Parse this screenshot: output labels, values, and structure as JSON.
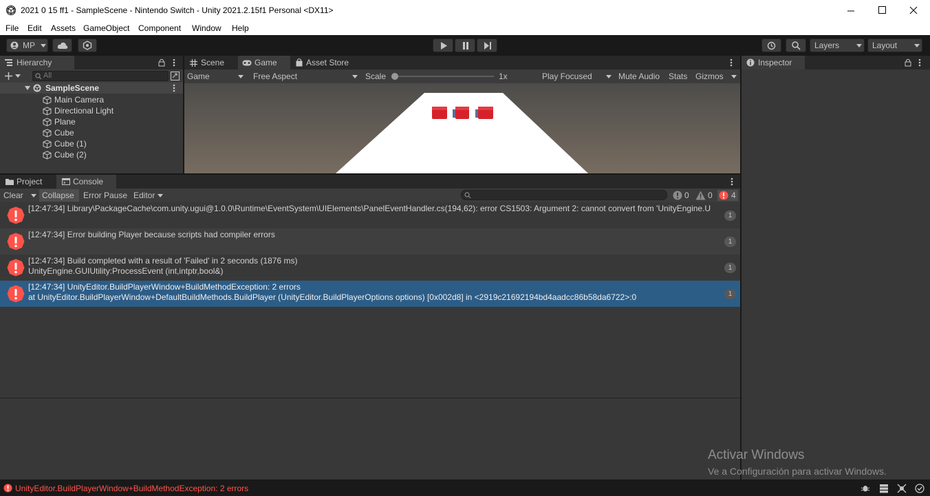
{
  "window": {
    "title": "2021 0 15 ff1 - SampleScene - Nintendo Switch - Unity 2021.2.15f1 Personal <DX11>"
  },
  "menu": [
    "File",
    "Edit",
    "Assets",
    "GameObject",
    "Component",
    "Window",
    "Help"
  ],
  "toolbar": {
    "account": "MP",
    "layers": "Layers",
    "layout": "Layout"
  },
  "hierarchy": {
    "tab": "Hierarchy",
    "search_placeholder": "All",
    "scene": "SampleScene",
    "items": [
      "Main Camera",
      "Directional Light",
      "Plane",
      "Cube",
      "Cube (1)",
      "Cube (2)"
    ]
  },
  "center_tabs": [
    "Scene",
    "Game",
    "Asset Store"
  ],
  "game_bar": {
    "display": "Game",
    "aspect": "Free Aspect",
    "scale_label": "Scale",
    "scale_value": "1x",
    "play_mode": "Play Focused",
    "mute": "Mute Audio",
    "stats": "Stats",
    "gizmos": "Gizmos"
  },
  "inspector": {
    "tab": "Inspector"
  },
  "bottom_tabs": [
    "Project",
    "Console"
  ],
  "console": {
    "clear": "Clear",
    "collapse": "Collapse",
    "error_pause": "Error Pause",
    "editor": "Editor",
    "info_count": "0",
    "warn_count": "0",
    "error_count": "4",
    "logs": [
      {
        "line1": "[12:47:34] Library\\PackageCache\\com.unity.ugui@1.0.0\\Runtime\\EventSystem\\UIElements\\PanelEventHandler.cs(194,62): error CS1503: Argument 2: cannot convert from 'UnityEngine.U",
        "line2": "",
        "count": "1",
        "selected": false
      },
      {
        "line1": "[12:47:34] Error building Player because scripts had compiler errors",
        "line2": "",
        "count": "1",
        "selected": false
      },
      {
        "line1": "[12:47:34] Build completed with a result of 'Failed' in 2 seconds (1876 ms)",
        "line2": "UnityEngine.GUIUtility:ProcessEvent (int,intptr,bool&)",
        "count": "1",
        "selected": false
      },
      {
        "line1": "[12:47:34] UnityEditor.BuildPlayerWindow+BuildMethodException: 2 errors",
        "line2": " at UnityEditor.BuildPlayerWindow+DefaultBuildMethods.BuildPlayer (UnityEditor.BuildPlayerOptions options) [0x002d8] in <2919c21692194bd4aadcc86b58da6722>:0",
        "count": "1",
        "selected": true
      }
    ]
  },
  "status_bar": {
    "message": "UnityEditor.BuildPlayerWindow+BuildMethodException: 2 errors"
  },
  "watermark": {
    "line1": "Activar Windows",
    "line2": "Ve a Configuración para activar Windows."
  },
  "colors": {
    "error": "#ff534a",
    "selection": "#2c5d87",
    "cube": "#d7212a"
  }
}
